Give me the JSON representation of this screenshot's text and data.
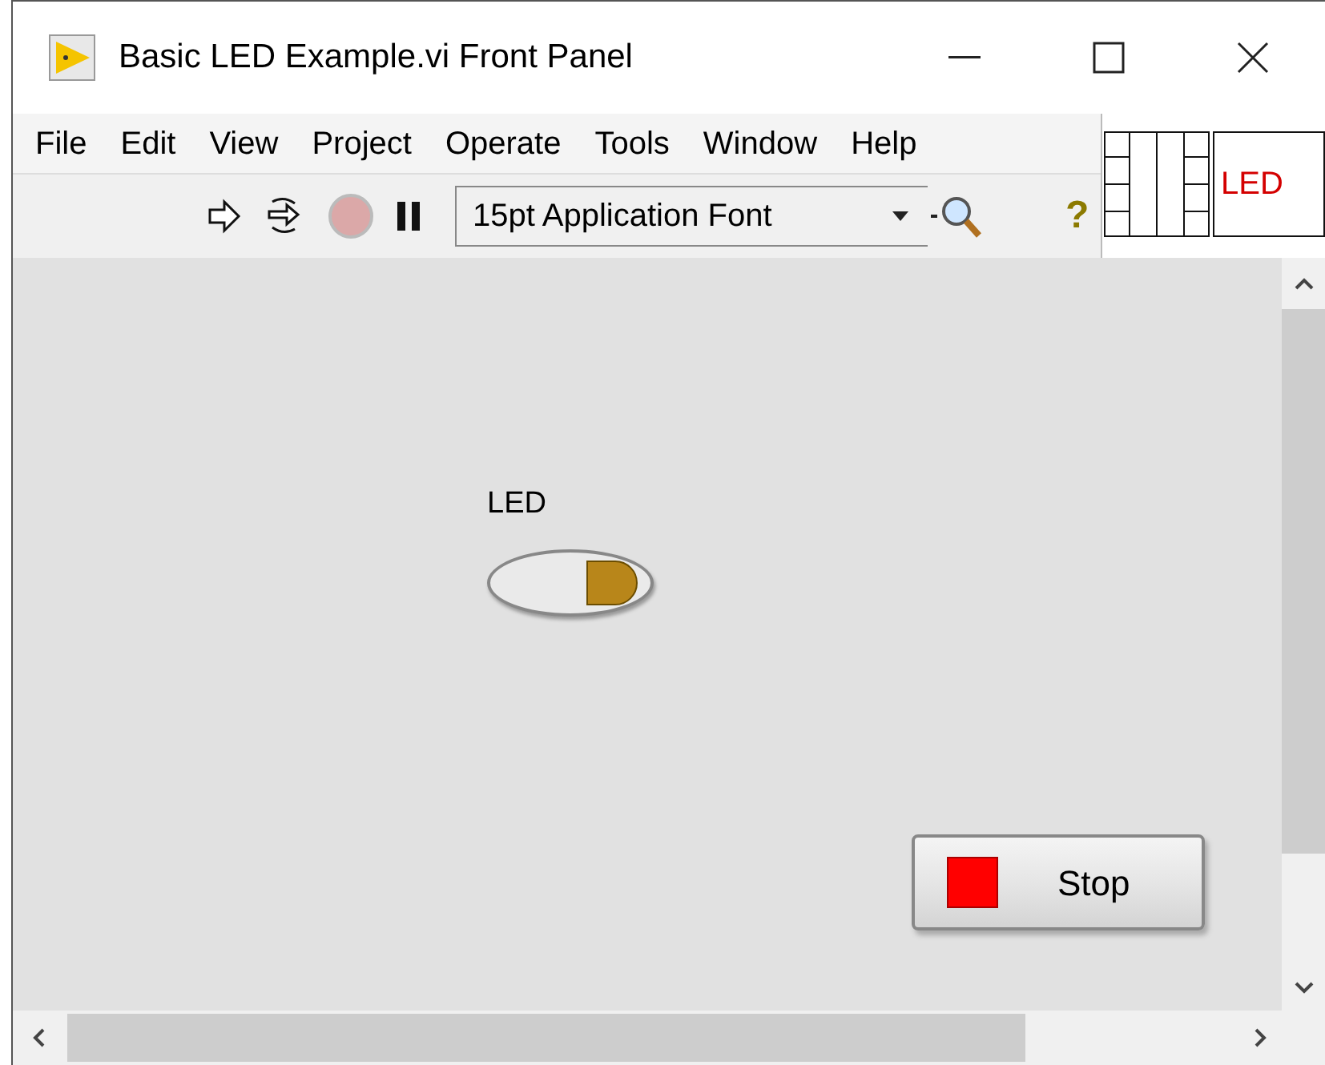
{
  "window": {
    "title": "Basic LED Example.vi Front Panel"
  },
  "menu": [
    "File",
    "Edit",
    "View",
    "Project",
    "Operate",
    "Tools",
    "Window",
    "Help"
  ],
  "toolbar": {
    "font": "15pt Application Font",
    "help": "?"
  },
  "icon_pane": {
    "label": "LED"
  },
  "panel": {
    "led": {
      "label": "LED",
      "on": false
    },
    "stop_button": {
      "label": "Stop"
    }
  }
}
